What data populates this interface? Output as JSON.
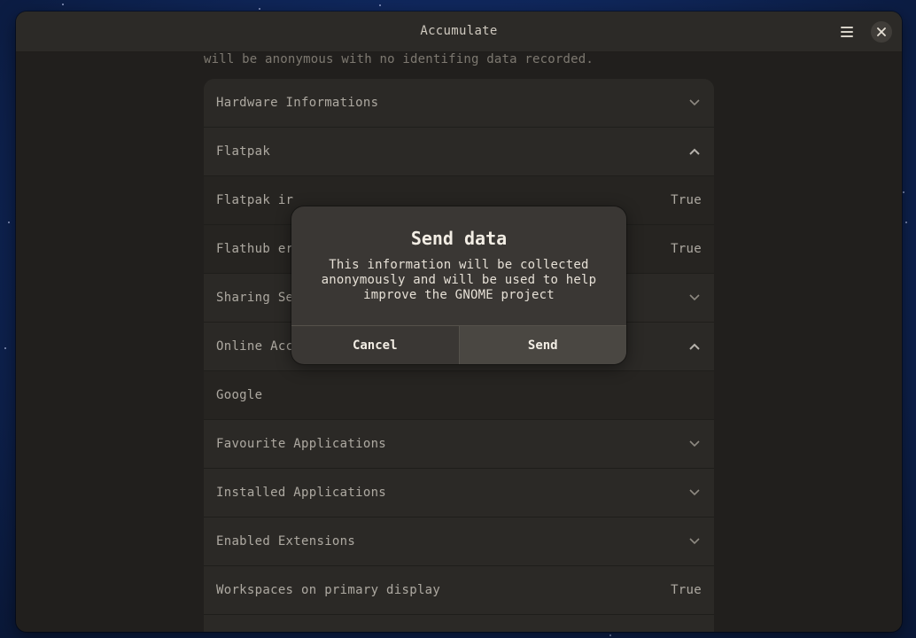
{
  "window": {
    "title": "Accumulate",
    "menu_icon": "hamburger-menu-icon",
    "close_icon": "close-icon"
  },
  "intro_text": "will be anonymous with no identifing data recorded.",
  "sections": [
    {
      "label": "Hardware Informations",
      "type": "expander",
      "expanded": false
    },
    {
      "label": "Flatpak",
      "type": "expander",
      "expanded": true
    },
    {
      "label": "Flatpak ir",
      "type": "value",
      "value": "True"
    },
    {
      "label": "Flathub er",
      "type": "value",
      "value": "True"
    },
    {
      "label": "Sharing Se",
      "type": "expander",
      "expanded": false
    },
    {
      "label": "Online Accounts",
      "type": "expander",
      "expanded": true
    },
    {
      "label": "Google",
      "type": "item"
    },
    {
      "label": "Favourite Applications",
      "type": "expander",
      "expanded": false
    },
    {
      "label": "Installed Applications",
      "type": "expander",
      "expanded": false
    },
    {
      "label": "Enabled Extensions",
      "type": "expander",
      "expanded": false
    },
    {
      "label": "Workspaces on primary display",
      "type": "value",
      "value": "True"
    }
  ],
  "dialog": {
    "title": "Send data",
    "body_line1": "This information will be collected",
    "body_line2": "anonymously and will be used to help",
    "body_line3": "improve the GNOME project",
    "cancel_label": "Cancel",
    "send_label": "Send"
  },
  "colors": {
    "window_bg": "#2c2a27",
    "row_bg": "#3a3733",
    "text": "#e6e0d6",
    "desktop": "#10285e"
  }
}
